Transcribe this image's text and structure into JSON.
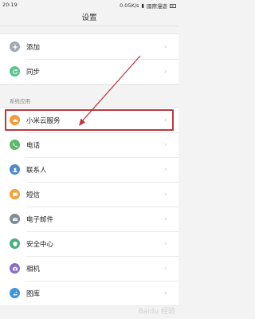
{
  "status_bar": {
    "time": "20:19",
    "network_speed": "0.05K/s",
    "carrier": "國際漫遊",
    "battery_icon": "battery-icon"
  },
  "page_title": "设置",
  "top_group": [
    {
      "label": "添加",
      "icon": "plus-icon",
      "color": "#9fa8b3"
    },
    {
      "label": "同步",
      "icon": "sync-icon",
      "color": "#5bc38f"
    }
  ],
  "section_label": "系统应用",
  "apps_group": [
    {
      "label": "小米云服务",
      "icon": "cloud-icon",
      "color": "#f39a3d"
    },
    {
      "label": "电话",
      "icon": "phone-icon",
      "color": "#5bb86a"
    },
    {
      "label": "联系人",
      "icon": "contacts-icon",
      "color": "#4f89c8"
    },
    {
      "label": "短信",
      "icon": "message-icon",
      "color": "#f0a23c"
    },
    {
      "label": "电子邮件",
      "icon": "mail-icon",
      "color": "#7f8b97"
    },
    {
      "label": "安全中心",
      "icon": "shield-icon",
      "color": "#4caf7d"
    },
    {
      "label": "相机",
      "icon": "camera-icon",
      "color": "#8a6bc7"
    },
    {
      "label": "图库",
      "icon": "gallery-icon",
      "color": "#3f95d9"
    }
  ],
  "annotation": {
    "highlight_color": "#b83b3f",
    "arrow_color": "#b83b3f"
  },
  "watermark": "Baidu 经验"
}
